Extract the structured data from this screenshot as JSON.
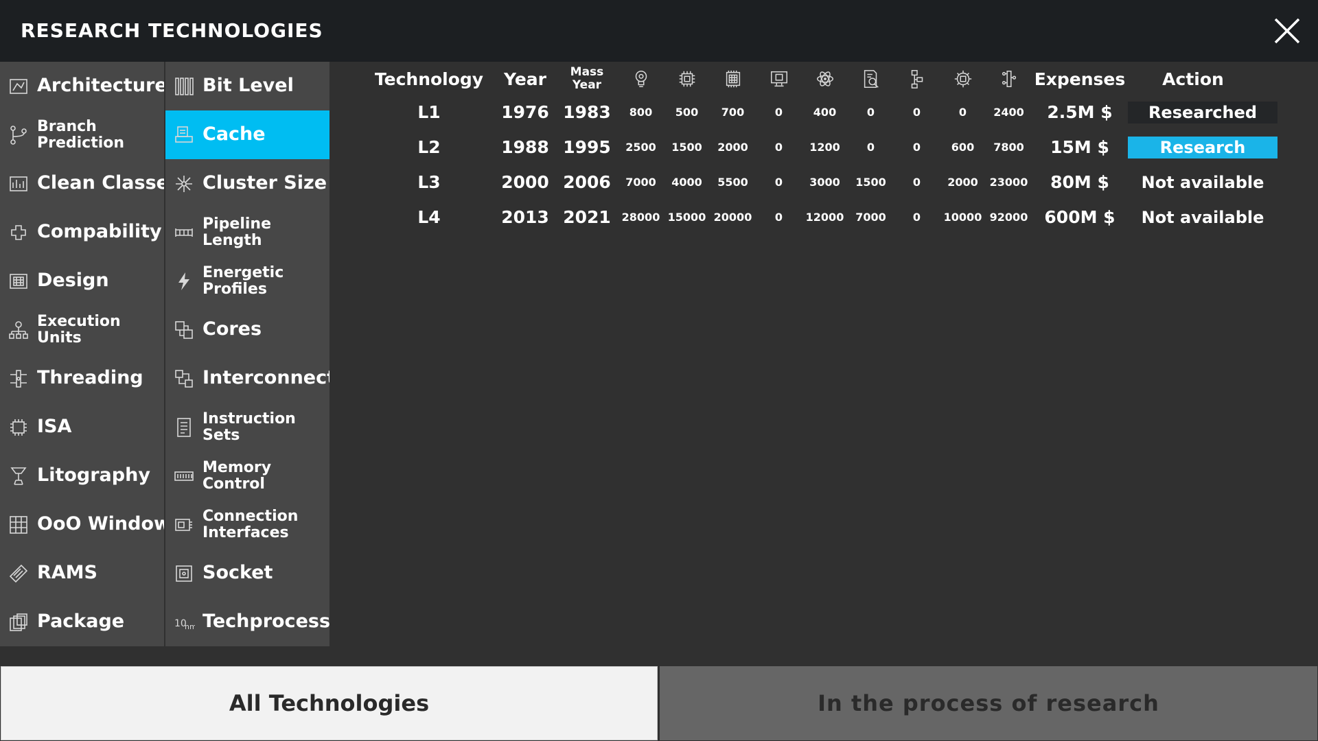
{
  "header": {
    "title": "RESEARCH TECHNOLOGIES"
  },
  "categories": [
    {
      "label": "Architecture",
      "icon": "architecture-icon",
      "two_line": false,
      "selected": false
    },
    {
      "label": "Bit Level",
      "icon": "bit-level-icon",
      "two_line": false,
      "selected": false
    },
    {
      "label": "Branch Prediction",
      "icon": "branch-prediction-icon",
      "two_line": true,
      "selected": false
    },
    {
      "label": "Cache",
      "icon": "cache-icon",
      "two_line": false,
      "selected": true
    },
    {
      "label": "Clean Classes",
      "icon": "clean-classes-icon",
      "two_line": false,
      "selected": false
    },
    {
      "label": "Cluster Size",
      "icon": "cluster-size-icon",
      "two_line": false,
      "selected": false
    },
    {
      "label": "Compability",
      "icon": "compability-icon",
      "two_line": false,
      "selected": false
    },
    {
      "label": "Pipeline Length",
      "icon": "pipeline-length-icon",
      "two_line": true,
      "selected": false
    },
    {
      "label": "Design",
      "icon": "design-icon",
      "two_line": false,
      "selected": false
    },
    {
      "label": "Energetic Profiles",
      "icon": "lightning-icon",
      "two_line": true,
      "selected": false
    },
    {
      "label": "Execution Units",
      "icon": "execution-units-icon",
      "two_line": true,
      "selected": false
    },
    {
      "label": "Cores",
      "icon": "cores-icon",
      "two_line": false,
      "selected": false
    },
    {
      "label": "Threading",
      "icon": "threading-icon",
      "two_line": false,
      "selected": false
    },
    {
      "label": "Interconnect",
      "icon": "interconnect-icon",
      "two_line": false,
      "selected": false
    },
    {
      "label": "ISA",
      "icon": "isa-chip-icon",
      "two_line": false,
      "selected": false
    },
    {
      "label": "Instruction Sets",
      "icon": "instruction-sets-icon",
      "two_line": true,
      "selected": false
    },
    {
      "label": "Litography",
      "icon": "litography-icon",
      "two_line": false,
      "selected": false
    },
    {
      "label": "Memory Control",
      "icon": "memory-control-icon",
      "two_line": true,
      "selected": false
    },
    {
      "label": "OoO Window",
      "icon": "ooo-window-icon",
      "two_line": false,
      "selected": false
    },
    {
      "label": "Connection Interfaces",
      "icon": "connection-interfaces-icon",
      "two_line": true,
      "selected": false
    },
    {
      "label": "RAMS",
      "icon": "ram-icon",
      "two_line": false,
      "selected": false
    },
    {
      "label": "Socket",
      "icon": "socket-icon",
      "two_line": false,
      "selected": false
    },
    {
      "label": "Package",
      "icon": "package-icon",
      "two_line": false,
      "selected": false
    },
    {
      "label": "Techprocess",
      "icon": "techprocess-icon",
      "two_line": false,
      "selected": false
    }
  ],
  "table": {
    "headers": {
      "technology": "Technology",
      "year": "Year",
      "mass_year": "Mass Year",
      "expenses": "Expenses",
      "action": "Action"
    },
    "resource_icons": [
      "lightbulb-gear-icon",
      "chip-icon",
      "processor-icon",
      "monitor-chip-icon",
      "atom-icon",
      "document-search-icon",
      "flowchart-icon",
      "gear-chip-icon",
      "circuit-icon"
    ],
    "rows": [
      {
        "tech": "L1",
        "year": "1976",
        "mass_year": "1983",
        "res": [
          "800",
          "500",
          "700",
          "0",
          "400",
          "0",
          "0",
          "0",
          "2400"
        ],
        "expenses": "2.5M $",
        "action": "Researched",
        "action_state": "researched"
      },
      {
        "tech": "L2",
        "year": "1988",
        "mass_year": "1995",
        "res": [
          "2500",
          "1500",
          "2000",
          "0",
          "1200",
          "0",
          "0",
          "600",
          "7800"
        ],
        "expenses": "15M $",
        "action": "Research",
        "action_state": "research"
      },
      {
        "tech": "L3",
        "year": "2000",
        "mass_year": "2006",
        "res": [
          "7000",
          "4000",
          "5500",
          "0",
          "3000",
          "1500",
          "0",
          "2000",
          "23000"
        ],
        "expenses": "80M $",
        "action": "Not available",
        "action_state": "unavailable"
      },
      {
        "tech": "L4",
        "year": "2013",
        "mass_year": "2021",
        "res": [
          "28000",
          "15000",
          "20000",
          "0",
          "12000",
          "7000",
          "0",
          "10000",
          "92000"
        ],
        "expenses": "600M $",
        "action": "Not available",
        "action_state": "unavailable"
      }
    ]
  },
  "bottom_tabs": {
    "all": "All Technologies",
    "in_process": "In the process of research"
  },
  "colors": {
    "selected": "#00bdf2",
    "research_button": "#1ab4e8"
  }
}
